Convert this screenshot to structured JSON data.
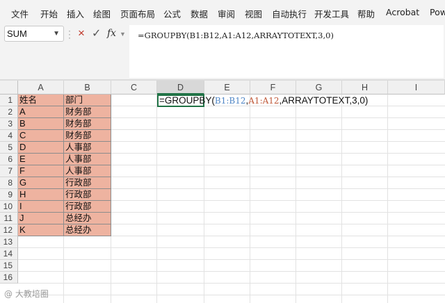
{
  "ribbon": {
    "menu": [
      "文件",
      "开始",
      "插入",
      "绘图",
      "页面布局",
      "公式",
      "数据",
      "审阅",
      "视图",
      "自动执行",
      "开发工具",
      "帮助",
      "Acrobat",
      "Pow"
    ]
  },
  "formula_bar": {
    "name_box": "SUM",
    "cancel_icon": "×",
    "confirm_icon": "✓",
    "fx_icon": "fx",
    "formula_text": "=GROUPBY(B1:B12,A1:A12,ARRAYTOTEXT,3,0)"
  },
  "columns": [
    "A",
    "B",
    "C",
    "D",
    "E",
    "F",
    "G",
    "H",
    "I"
  ],
  "rows": [
    "1",
    "2",
    "3",
    "4",
    "5",
    "6",
    "7",
    "8",
    "9",
    "10",
    "11",
    "12",
    "13",
    "14",
    "15",
    "16"
  ],
  "table": {
    "header": [
      "姓名",
      "部门"
    ],
    "rows": [
      [
        "A",
        "财务部"
      ],
      [
        "B",
        "财务部"
      ],
      [
        "C",
        "财务部"
      ],
      [
        "D",
        "人事部"
      ],
      [
        "E",
        "人事部"
      ],
      [
        "F",
        "人事部"
      ],
      [
        "G",
        "行政部"
      ],
      [
        "H",
        "行政部"
      ],
      [
        "I",
        "行政部"
      ],
      [
        "J",
        "总经办"
      ],
      [
        "K",
        "总经办"
      ]
    ]
  },
  "active_cell": {
    "prefix": "=GROUPBY(",
    "ref1": "B1:B12",
    "comma1": ",",
    "ref2": "A1:A12",
    "suffix": ",ARRAYTOTEXT,3,0)"
  },
  "watermark": "@ 大教培圈",
  "colors": {
    "table_fill": "#eeb3a0",
    "active_border": "#217346",
    "ref1": "#4f86c6",
    "ref2": "#c05a3a"
  }
}
